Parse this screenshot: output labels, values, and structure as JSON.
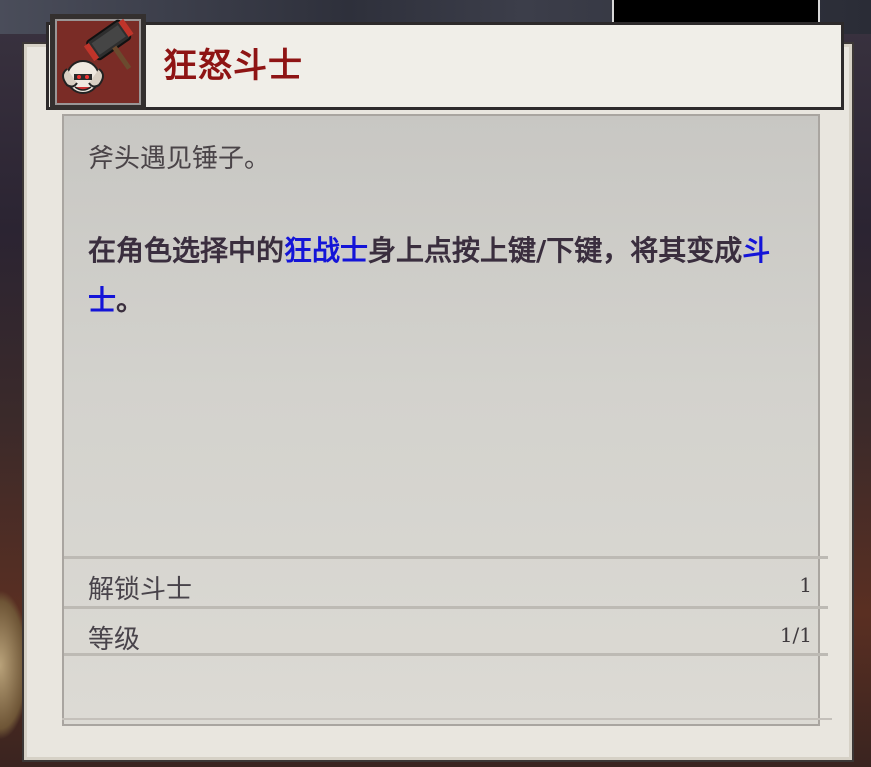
{
  "card": {
    "title": "狂怒斗士",
    "icon": "berserker-hammer-portrait-icon",
    "flavor_text": "斧头遇见锤子。",
    "description": {
      "part1": "在角色选择中的",
      "highlight1": "狂战士",
      "part2": "身上点按上键/下键，将其变成",
      "highlight2": "斗士",
      "part3": "。"
    },
    "stats": [
      {
        "label": "解锁斗士",
        "value": "1"
      },
      {
        "label": "等级",
        "value": "1/1"
      }
    ]
  },
  "colors": {
    "title": "#8e1414",
    "highlight": "#1414d8",
    "text": "#3a2e3e"
  }
}
